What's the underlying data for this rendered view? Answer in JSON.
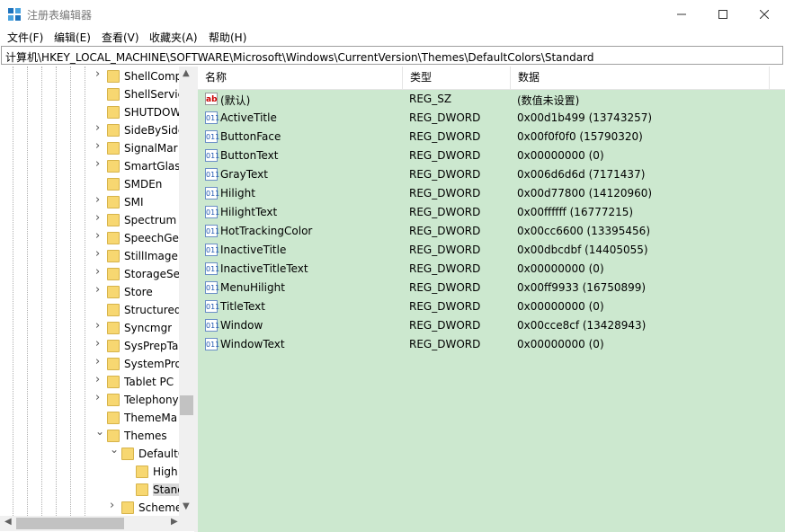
{
  "window": {
    "title": "注册表编辑器"
  },
  "menu": [
    "文件(F)",
    "编辑(E)",
    "查看(V)",
    "收藏夹(A)",
    "帮助(H)"
  ],
  "address": "计算机\\HKEY_LOCAL_MACHINE\\SOFTWARE\\Microsoft\\Windows\\CurrentVersion\\Themes\\DefaultColors\\Standard",
  "tree": {
    "items": [
      {
        "label": "ShellComp",
        "expandable": true
      },
      {
        "label": "ShellServic",
        "expandable": false
      },
      {
        "label": "SHUTDOW",
        "expandable": false
      },
      {
        "label": "SideBySide",
        "expandable": true
      },
      {
        "label": "SignalMar",
        "expandable": true
      },
      {
        "label": "SmartGlas",
        "expandable": true
      },
      {
        "label": "SMDEn",
        "expandable": false
      },
      {
        "label": "SMI",
        "expandable": true
      },
      {
        "label": "Spectrum",
        "expandable": true
      },
      {
        "label": "SpeechGe",
        "expandable": true
      },
      {
        "label": "StillImage",
        "expandable": true
      },
      {
        "label": "StorageSe",
        "expandable": true
      },
      {
        "label": "Store",
        "expandable": true
      },
      {
        "label": "Structured",
        "expandable": false
      },
      {
        "label": "Syncmgr",
        "expandable": true
      },
      {
        "label": "SysPrepTa",
        "expandable": true
      },
      {
        "label": "SystemPro",
        "expandable": true
      },
      {
        "label": "Tablet PC",
        "expandable": true
      },
      {
        "label": "Telephony",
        "expandable": true
      },
      {
        "label": "ThemeMa",
        "expandable": false
      },
      {
        "label": "Themes",
        "expandable": "open"
      },
      {
        "label": "DefaultC",
        "expandable": "open"
      },
      {
        "label": "High",
        "expandable": false
      },
      {
        "label": "Stanc",
        "expandable": false,
        "selected": true
      },
      {
        "label": "Scheme",
        "expandable": true
      }
    ]
  },
  "columns": {
    "name": "名称",
    "type": "类型",
    "data": "数据"
  },
  "values": [
    {
      "name": "(默认)",
      "type": "REG_SZ",
      "data": "(数值未设置)",
      "icon": "ab"
    },
    {
      "name": "ActiveTitle",
      "type": "REG_DWORD",
      "data": "0x00d1b499 (13743257)",
      "icon": "dw"
    },
    {
      "name": "ButtonFace",
      "type": "REG_DWORD",
      "data": "0x00f0f0f0 (15790320)",
      "icon": "dw"
    },
    {
      "name": "ButtonText",
      "type": "REG_DWORD",
      "data": "0x00000000 (0)",
      "icon": "dw"
    },
    {
      "name": "GrayText",
      "type": "REG_DWORD",
      "data": "0x006d6d6d (7171437)",
      "icon": "dw"
    },
    {
      "name": "Hilight",
      "type": "REG_DWORD",
      "data": "0x00d77800 (14120960)",
      "icon": "dw"
    },
    {
      "name": "HilightText",
      "type": "REG_DWORD",
      "data": "0x00ffffff (16777215)",
      "icon": "dw"
    },
    {
      "name": "HotTrackingColor",
      "type": "REG_DWORD",
      "data": "0x00cc6600 (13395456)",
      "icon": "dw"
    },
    {
      "name": "InactiveTitle",
      "type": "REG_DWORD",
      "data": "0x00dbcdbf (14405055)",
      "icon": "dw"
    },
    {
      "name": "InactiveTitleText",
      "type": "REG_DWORD",
      "data": "0x00000000 (0)",
      "icon": "dw"
    },
    {
      "name": "MenuHilight",
      "type": "REG_DWORD",
      "data": "0x00ff9933 (16750899)",
      "icon": "dw"
    },
    {
      "name": "TitleText",
      "type": "REG_DWORD",
      "data": "0x00000000 (0)",
      "icon": "dw"
    },
    {
      "name": "Window",
      "type": "REG_DWORD",
      "data": "0x00cce8cf (13428943)",
      "icon": "dw"
    },
    {
      "name": "WindowText",
      "type": "REG_DWORD",
      "data": "0x00000000 (0)",
      "icon": "dw"
    }
  ],
  "colors": {
    "values_bg": "#cce8cf",
    "folder": "#f7d771"
  }
}
